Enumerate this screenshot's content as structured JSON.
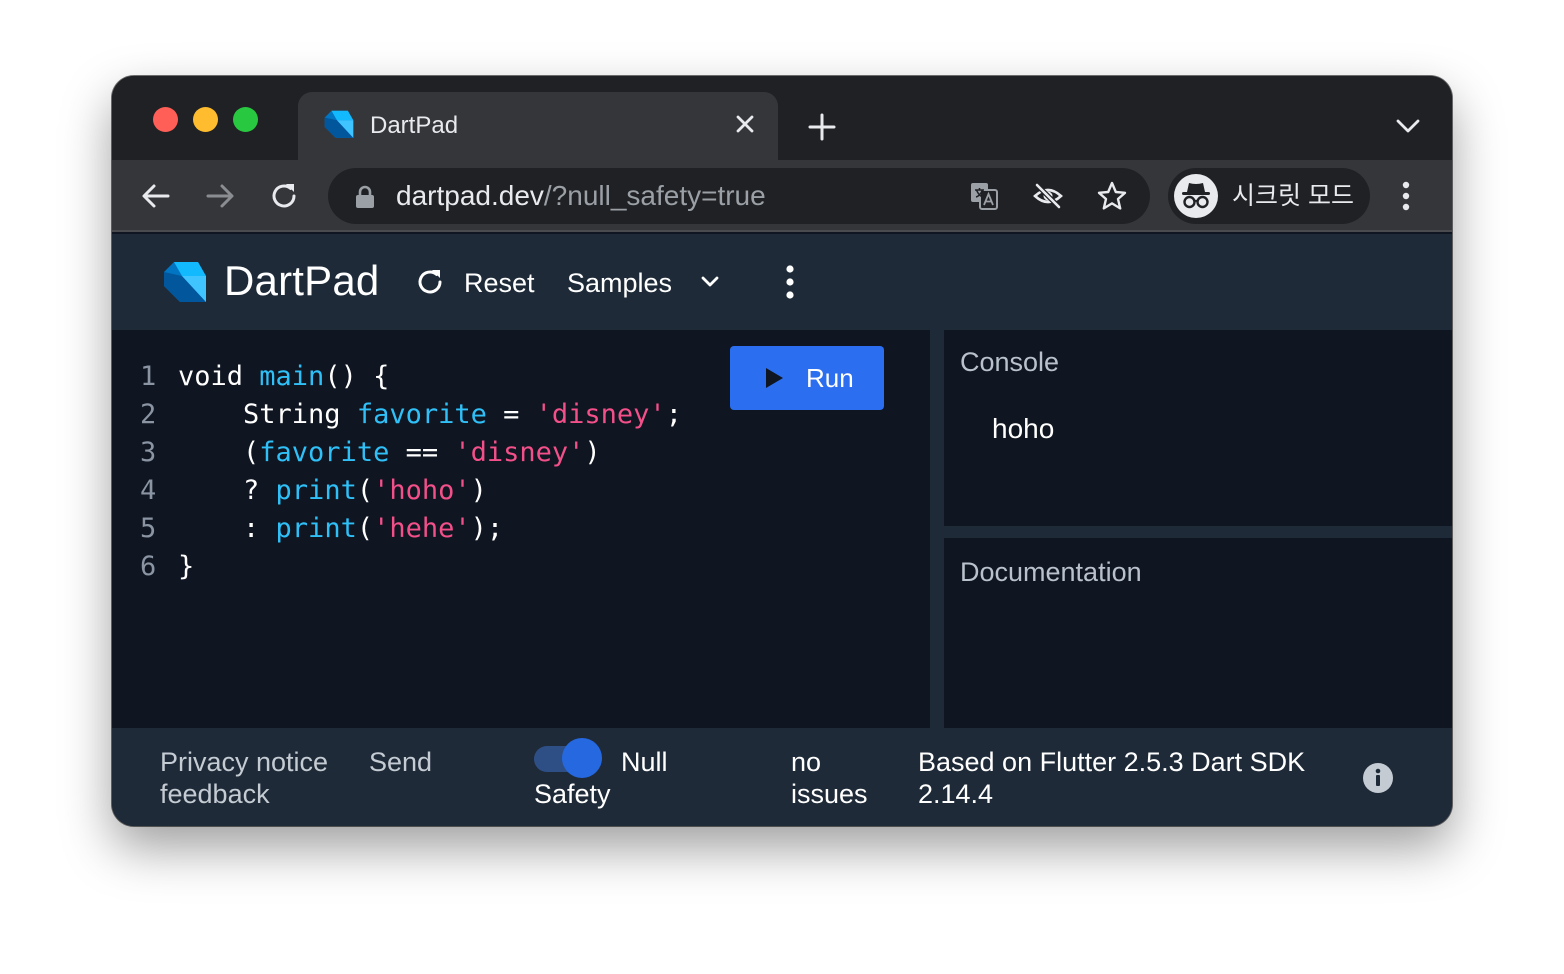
{
  "browser": {
    "tab_title": "DartPad",
    "url_host": "dartpad.dev",
    "url_rest": "/?null_safety=true",
    "incognito_label": "시크릿 모드",
    "icons": [
      "back-arrow-icon",
      "forward-arrow-icon",
      "reload-icon",
      "lock-icon",
      "translate-icon",
      "eye-off-icon",
      "star-icon",
      "incognito-icon",
      "more-vert-icon"
    ]
  },
  "header": {
    "title": "DartPad",
    "reset_label": "Reset",
    "samples_label": "Samples"
  },
  "editor": {
    "run_label": "Run",
    "lines": [
      {
        "num": "1",
        "tokens": [
          {
            "t": "void ",
            "c": "plain"
          },
          {
            "t": "main",
            "c": "fn"
          },
          {
            "t": "() {",
            "c": "plain"
          }
        ]
      },
      {
        "num": "2",
        "tokens": [
          {
            "t": "    String ",
            "c": "plain"
          },
          {
            "t": "favorite",
            "c": "fn"
          },
          {
            "t": " = ",
            "c": "plain"
          },
          {
            "t": "'disney'",
            "c": "str"
          },
          {
            "t": ";",
            "c": "plain"
          }
        ]
      },
      {
        "num": "3",
        "tokens": [
          {
            "t": "    (",
            "c": "plain"
          },
          {
            "t": "favorite",
            "c": "fn"
          },
          {
            "t": " == ",
            "c": "plain"
          },
          {
            "t": "'disney'",
            "c": "str"
          },
          {
            "t": ")",
            "c": "plain"
          }
        ]
      },
      {
        "num": "4",
        "tokens": [
          {
            "t": "    ? ",
            "c": "plain"
          },
          {
            "t": "print",
            "c": "fn"
          },
          {
            "t": "(",
            "c": "plain"
          },
          {
            "t": "'hoho'",
            "c": "str"
          },
          {
            "t": ")",
            "c": "plain"
          }
        ]
      },
      {
        "num": "5",
        "tokens": [
          {
            "t": "    : ",
            "c": "plain"
          },
          {
            "t": "print",
            "c": "fn"
          },
          {
            "t": "(",
            "c": "plain"
          },
          {
            "t": "'hehe'",
            "c": "str"
          },
          {
            "t": ");",
            "c": "plain"
          }
        ]
      },
      {
        "num": "6",
        "tokens": [
          {
            "t": "}",
            "c": "plain"
          }
        ]
      }
    ]
  },
  "console": {
    "title": "Console",
    "output": "hoho"
  },
  "documentation": {
    "title": "Documentation"
  },
  "footer": {
    "privacy_label": "Privacy notice",
    "send_label": "Send",
    "feedback_label": "feedback",
    "null_label": "Null",
    "safety_label": "Safety",
    "null_safety_enabled": true,
    "issues_line1": "no",
    "issues_line2": "issues",
    "sdk_line1": "Based on Flutter 2.5.3 Dart SDK",
    "sdk_line2": "2.14.4"
  },
  "colors": {
    "code_function": "#30c0f8",
    "code_string": "#f3508a",
    "run_button": "#2b6ff0",
    "header_bg": "#1e2a38",
    "editor_bg": "#0f1521"
  }
}
